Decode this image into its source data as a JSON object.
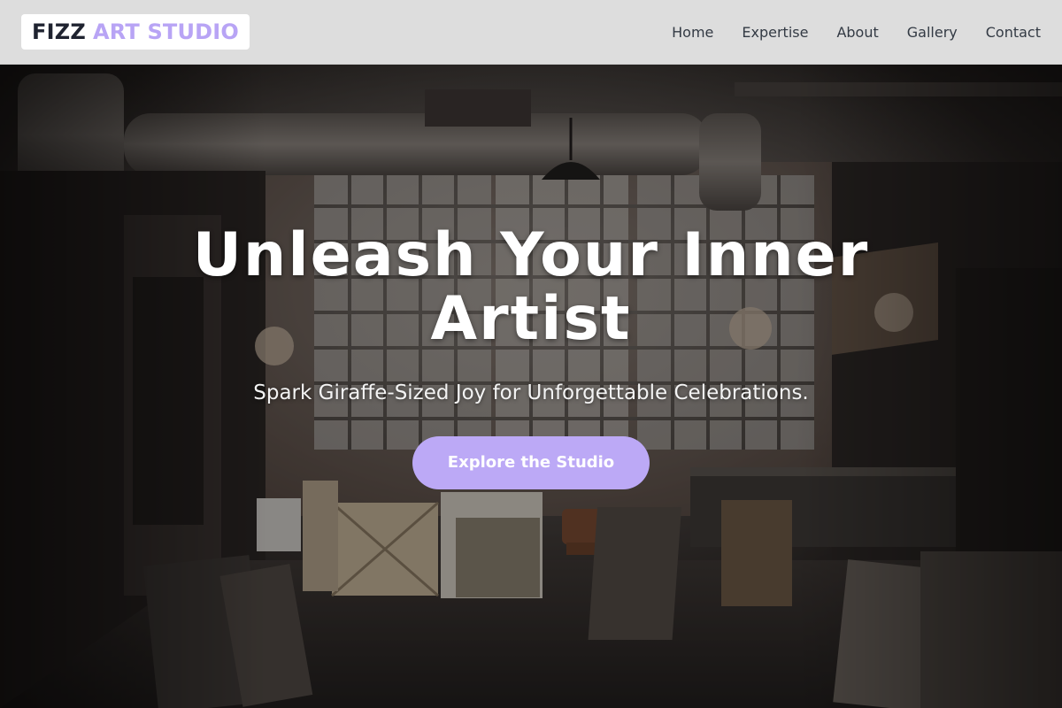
{
  "header": {
    "logo": {
      "word1": "FIZZ",
      "word2": "ART STUDIO"
    },
    "nav": [
      {
        "label": "Home"
      },
      {
        "label": "Expertise"
      },
      {
        "label": "About"
      },
      {
        "label": "Gallery"
      },
      {
        "label": "Contact"
      }
    ]
  },
  "hero": {
    "title": "Unleash Your Inner Artist",
    "subtitle": "Spark Giraffe-Sized Joy for Unforgettable Celebrations.",
    "cta_label": "Explore the Studio",
    "background_image": "industrial-art-studio-photo"
  },
  "colors": {
    "accent": "#bca9f6",
    "logo_accent": "#b8a4f5",
    "header_bg": "#dddddd",
    "nav_text": "#333a44"
  }
}
